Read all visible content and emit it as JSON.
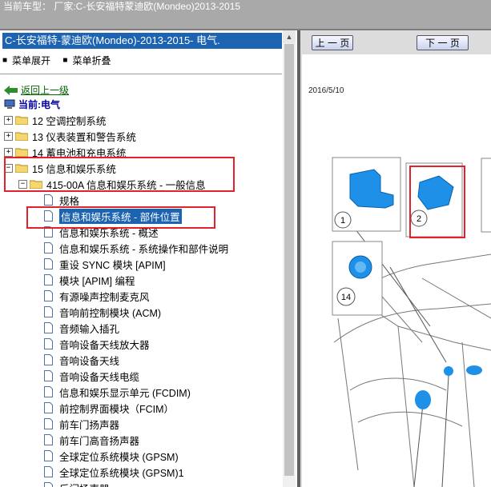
{
  "header": {
    "title": "当前车型：  厂家:C-长安福特蒙迪欧(Mondeo)2013-2015"
  },
  "left_panel": {
    "title": "C-长安福特-蒙迪欧(Mondeo)-2013-2015- 电气.",
    "expand_label": "菜单展开",
    "collapse_label": "菜单折叠",
    "back_label": "返回上一级",
    "current_label": "当前:电气",
    "tree": [
      {
        "label": "12 空调控制系统"
      },
      {
        "label": "13 仪表装置和警告系统"
      },
      {
        "label": "14 蓄电池和充电系统"
      },
      {
        "label": "15 信息和娱乐系统"
      },
      {
        "label": "415-00A 信息和娱乐系统 - 一般信息"
      },
      {
        "label": "规格"
      },
      {
        "label": "信息和娱乐系统 - 部件位置"
      },
      {
        "label": "信息和娱乐系统 - 概述"
      },
      {
        "label": "信息和娱乐系统 - 系统操作和部件说明"
      },
      {
        "label": "重设 SYNC 模块 [APIM]"
      },
      {
        "label": "模块 [APIM] 编程"
      },
      {
        "label": "有源噪声控制麦克风"
      },
      {
        "label": "音响前控制模块 (ACM)"
      },
      {
        "label": "音频输入插孔"
      },
      {
        "label": "音响设备天线放大器"
      },
      {
        "label": "音响设备天线"
      },
      {
        "label": "音响设备天线电缆"
      },
      {
        "label": "信息和娱乐显示单元 (FCDIM)"
      },
      {
        "label": "前控制界面模块（FCIM）"
      },
      {
        "label": "前车门扬声器"
      },
      {
        "label": "前车门高音扬声器"
      },
      {
        "label": "全球定位系统模块 (GPSM)"
      },
      {
        "label": "全球定位系统模块 (GPSM)1"
      },
      {
        "label": "后门扬声器"
      }
    ]
  },
  "right_panel": {
    "prev_label": "上 一 页",
    "next_label": "下 一 页",
    "doc_date": "2016/5/10",
    "callouts": [
      "1",
      "2",
      "14"
    ]
  },
  "colors": {
    "highlight": "#1c64b2",
    "annotation_red": "#e3212b",
    "component_blue": "#1e90e8"
  }
}
